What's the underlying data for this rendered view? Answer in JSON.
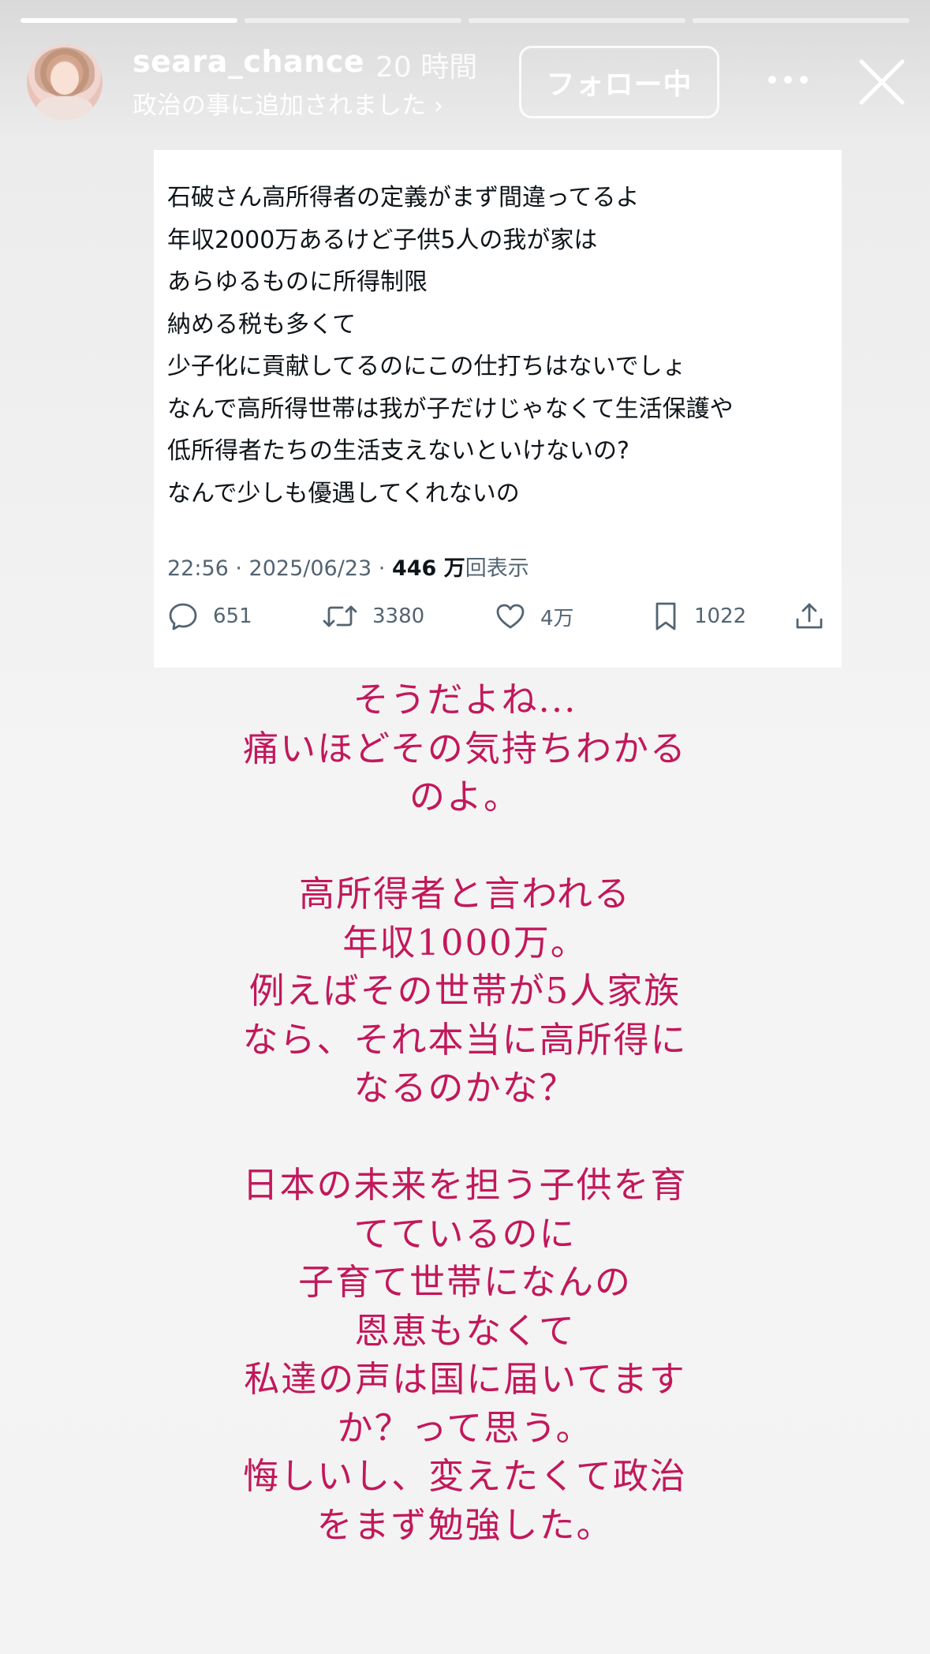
{
  "story": {
    "progress": [
      1,
      0,
      0,
      0
    ],
    "user": {
      "username": "seara_chance",
      "time_ago": "20 時間",
      "added_to": "政治の事に追加されました",
      "follow_label": "フォロー中"
    }
  },
  "tweet": {
    "lines": [
      "石破さん高所得者の定義がまず間違ってるよ",
      "年収2000万あるけど子供5人の我が家は",
      "あらゆるものに所得制限",
      "納める税も多くて",
      "少子化に貢献してるのにこの仕打ちはないでしょ",
      "なんで高所得世帯は我が子だけじゃなくて生活保護や",
      "低所得者たちの生活支えないといけないの?",
      "なんで少しも優遇してくれないの"
    ],
    "meta_prefix": "22:56 · 2025/06/23 · ",
    "views_count": "446 万",
    "views_label": "回表示",
    "actions": {
      "replies": "651",
      "reposts": "3380",
      "likes": "4万",
      "bookmarks": "1022"
    }
  },
  "caption": {
    "color": "#c2185b",
    "lines": [
      "そうだよね...",
      "痛いほどその気持ちわかる",
      "のよ。",
      "",
      "高所得者と言われる",
      "年収1000万。",
      "例えばその世帯が5人家族",
      "なら、それ本当に高所得に",
      "なるのかな？",
      "",
      "日本の未来を担う子供を育",
      "てているのに",
      "子育て世帯になんの",
      "恩恵もなくて",
      "私達の声は国に届いてます",
      "か？って思う。",
      "悔しいし、変えたくて政治",
      "をまず勉強した。"
    ]
  }
}
